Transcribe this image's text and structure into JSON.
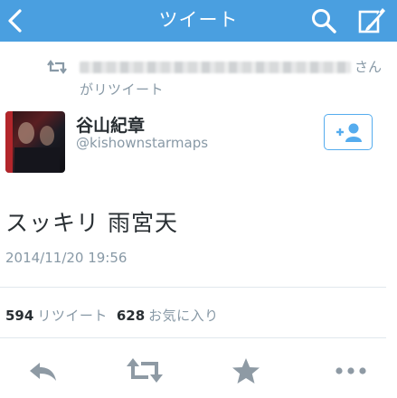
{
  "navbar": {
    "title": "ツイート",
    "color": "#4a9fe0",
    "back_icon": "chevron-left-icon",
    "search_icon": "search-icon",
    "compose_icon": "compose-icon"
  },
  "retweet_context": {
    "icon": "retweet-icon",
    "suffix": "さん",
    "text": "がリツイート"
  },
  "tweet": {
    "author_name": "谷山紀章",
    "author_handle": "@kishownstarmaps",
    "text": "スッキリ 雨宮天",
    "timestamp": "2014/11/20 19:56",
    "follow_icon": "add-user-icon"
  },
  "stats": {
    "retweets_count": "594",
    "retweets_label": "リツイート",
    "favorites_count": "628",
    "favorites_label": "お気に入り"
  },
  "actions": {
    "reply_icon": "reply-icon",
    "retweet_icon": "retweet-icon",
    "favorite_icon": "star-icon",
    "more_icon": "more-icon"
  },
  "colors": {
    "accent": "#55acee",
    "muted_text": "#8899a6",
    "action_gray": "#8e9aa4"
  }
}
